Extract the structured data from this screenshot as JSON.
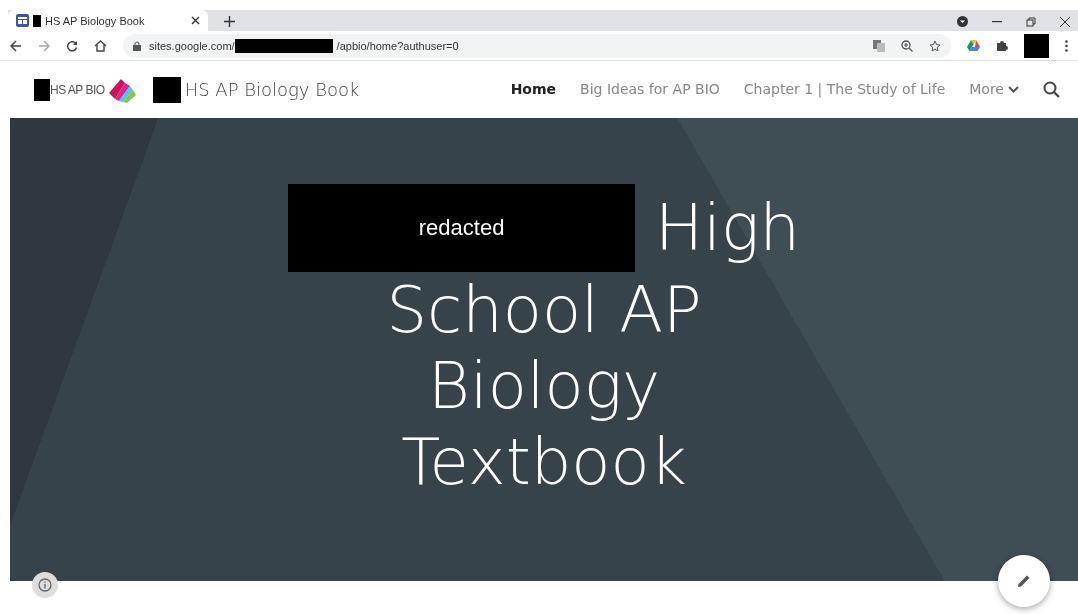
{
  "browser": {
    "tab": {
      "title": "HS AP Biology Book"
    },
    "url": {
      "host": "sites.google.com/",
      "path": "/apbio/home?authuser=0"
    }
  },
  "site": {
    "logo_text": "HS AP BIO",
    "title": "HS AP Biology Book",
    "nav": [
      {
        "label": "Home",
        "selected": true,
        "kind": "link"
      },
      {
        "label": "Big Ideas for AP BIO",
        "selected": false,
        "kind": "link"
      },
      {
        "label": "Chapter 1 | The Study of Life",
        "selected": false,
        "kind": "link"
      },
      {
        "label": "More",
        "selected": false,
        "kind": "menu"
      }
    ]
  },
  "hero": {
    "redaction_label": "redacted",
    "title_lines": [
      "High",
      "School AP",
      "Biology",
      "Textbook"
    ]
  }
}
